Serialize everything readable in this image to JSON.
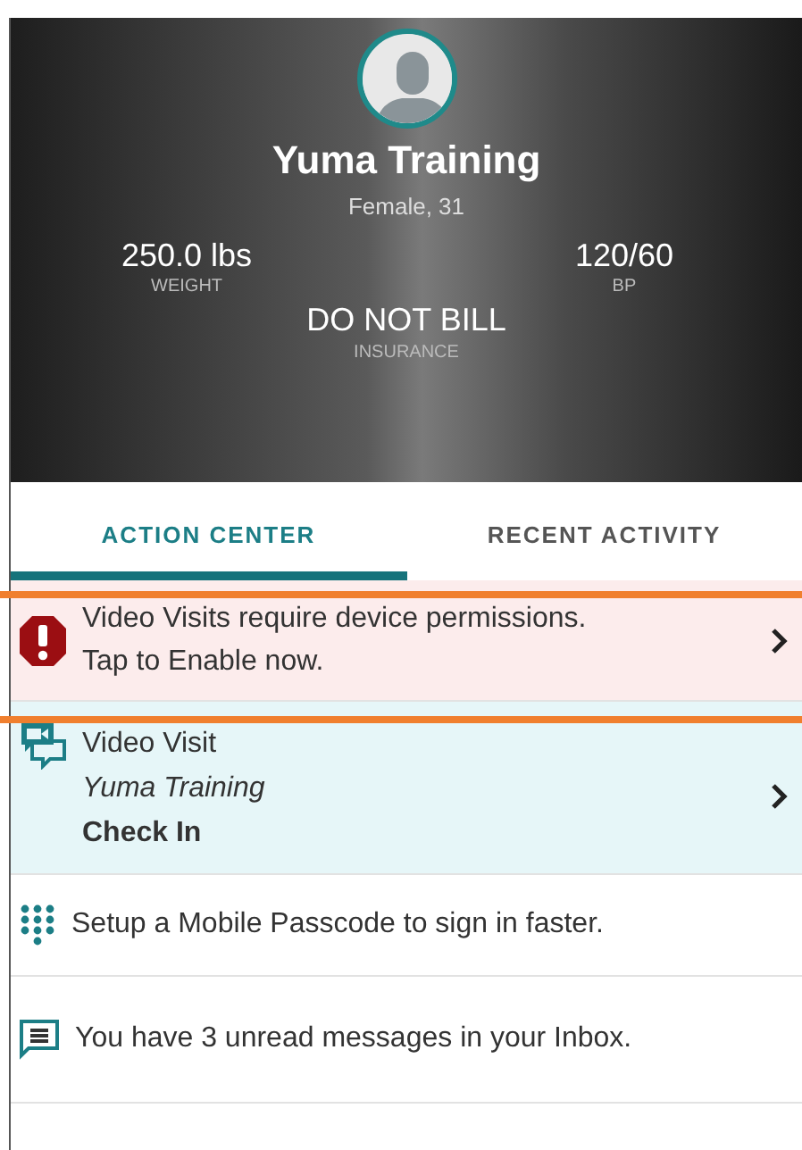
{
  "patient": {
    "name": "Yuma Training",
    "details": "Female, 31",
    "stats": [
      {
        "value": "250.0 lbs",
        "label": "WEIGHT"
      },
      {
        "value": "120/60",
        "label": "BP"
      }
    ],
    "insurance": {
      "value": "DO NOT BILL",
      "label": "INSURANCE"
    }
  },
  "tabs": [
    {
      "label": "ACTION CENTER",
      "selected": true
    },
    {
      "label": "RECENT ACTIVITY",
      "selected": false
    }
  ],
  "items": [
    {
      "kind": "alert",
      "lines": [
        "Video Visits require device permissions.",
        "Tap to Enable now."
      ]
    },
    {
      "kind": "visit",
      "title": "Video Visit",
      "subtitle": "Yuma Training",
      "action": "Check In"
    },
    {
      "kind": "passcode",
      "text": "Setup a Mobile Passcode to sign in faster."
    },
    {
      "kind": "inbox",
      "text": "You have 3 unread messages in your Inbox."
    }
  ]
}
